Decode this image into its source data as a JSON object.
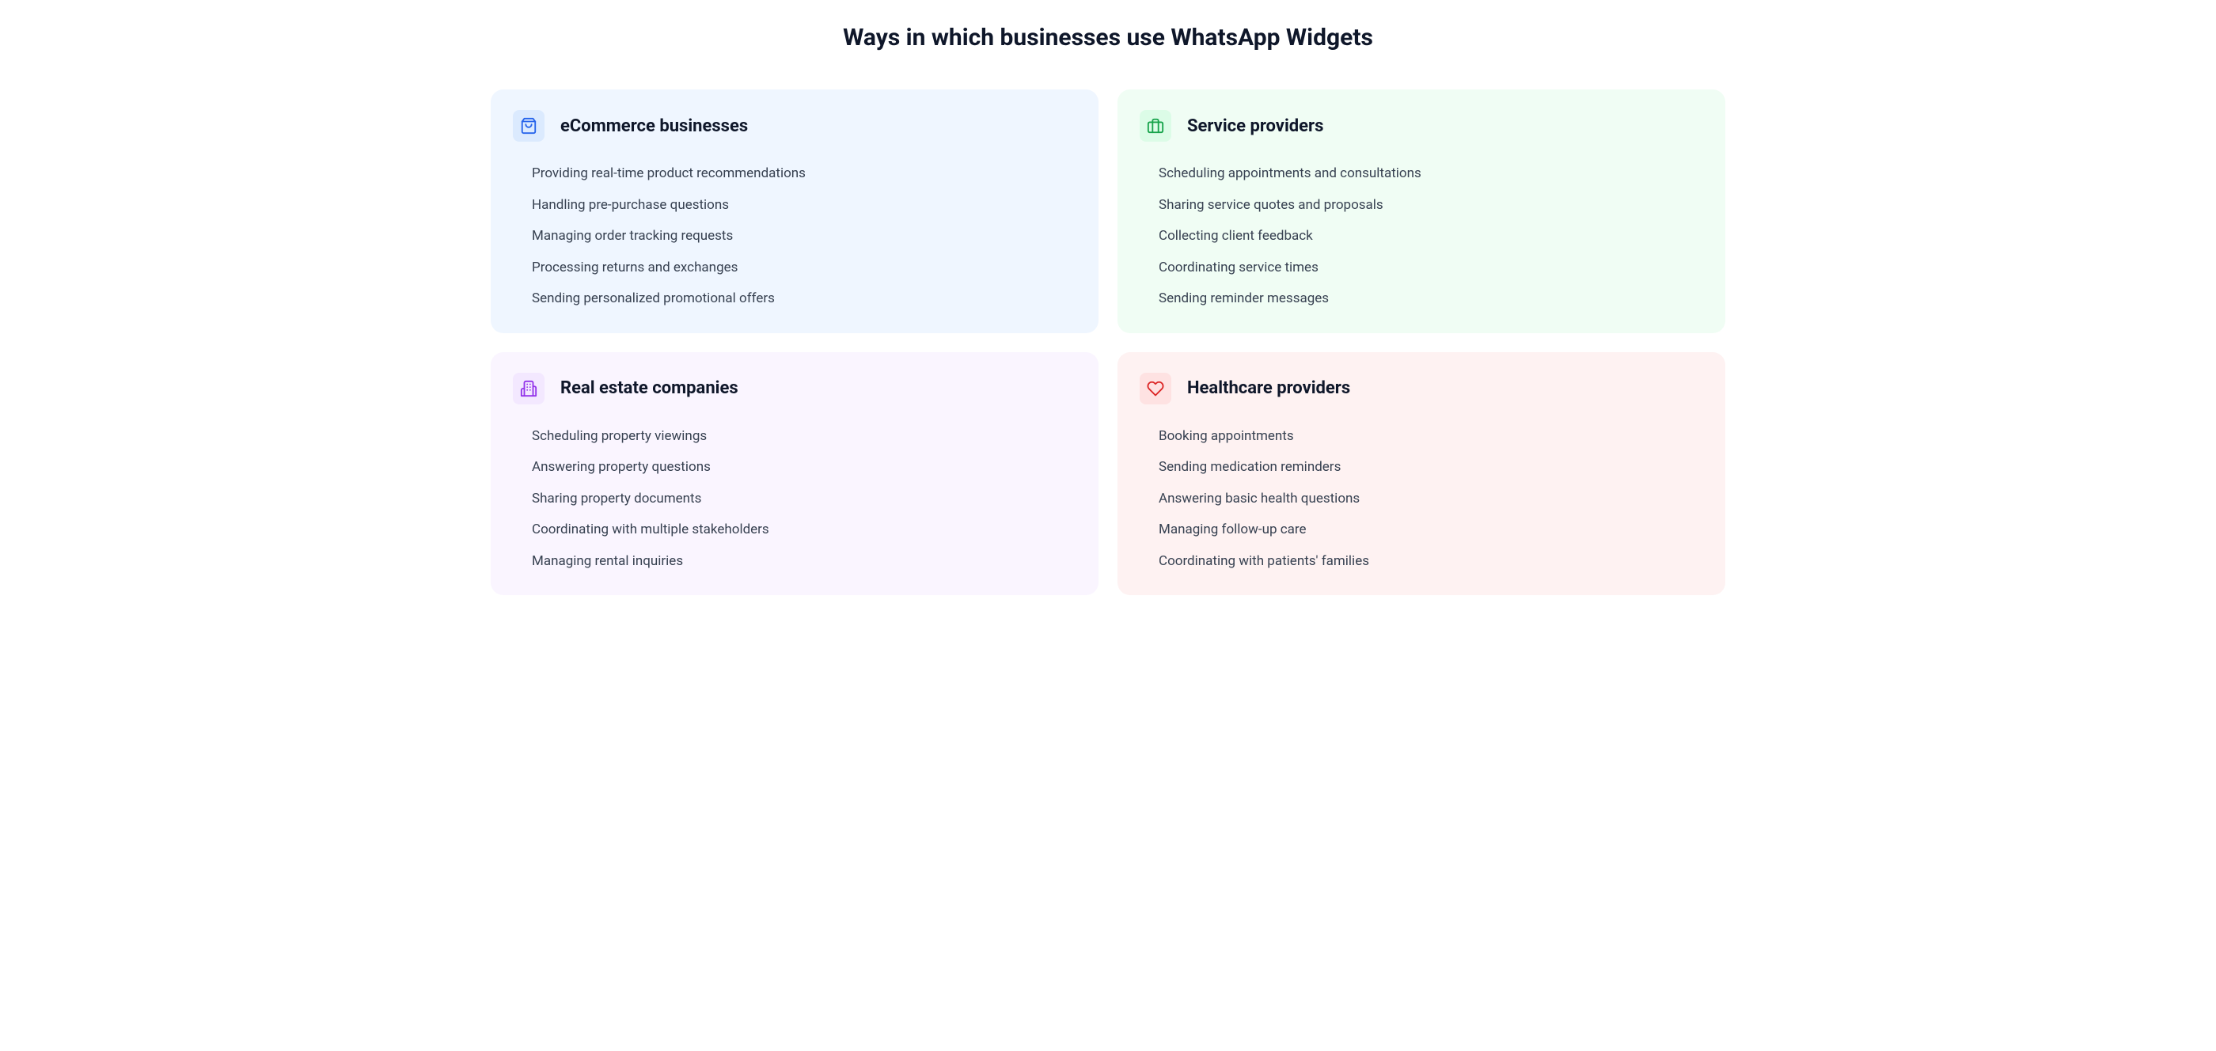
{
  "title": "Ways in which businesses use WhatsApp Widgets",
  "cards": [
    {
      "icon": "shopping-bag-icon",
      "title": "eCommerce businesses",
      "items": [
        "Providing real-time product recommendations",
        "Handling pre-purchase questions",
        "Managing order tracking requests",
        "Processing returns and exchanges",
        "Sending personalized promotional offers"
      ]
    },
    {
      "icon": "briefcase-icon",
      "title": "Service providers",
      "items": [
        "Scheduling appointments and consultations",
        "Sharing service quotes and proposals",
        "Collecting client feedback",
        "Coordinating service times",
        "Sending reminder messages"
      ]
    },
    {
      "icon": "building-icon",
      "title": "Real estate companies",
      "items": [
        "Scheduling property viewings",
        "Answering property questions",
        "Sharing property documents",
        "Coordinating with multiple stakeholders",
        "Managing rental inquiries"
      ]
    },
    {
      "icon": "heart-icon",
      "title": "Healthcare providers",
      "items": [
        "Booking appointments",
        "Sending medication reminders",
        "Answering basic health questions",
        "Managing follow-up care",
        "Coordinating with patients' families"
      ]
    }
  ]
}
